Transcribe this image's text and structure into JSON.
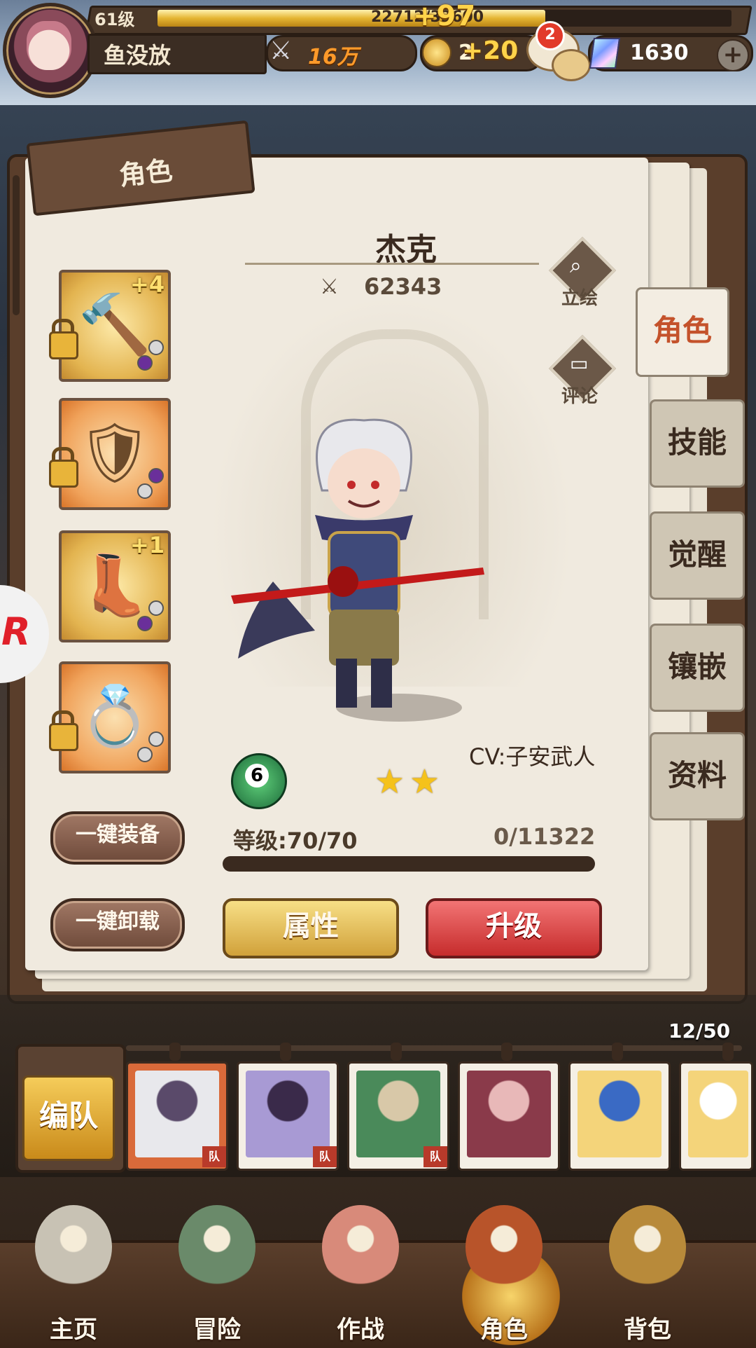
{
  "player": {
    "level": "61级",
    "name": "鱼没放",
    "xp_text": "22712/33600",
    "xp_fraction": 0.676,
    "xp_gain": "+97"
  },
  "resources": {
    "power": "16万",
    "gold": "2",
    "gold_gain": "+20",
    "gems": "1630",
    "chat_badge": "2",
    "plus": "+"
  },
  "panel": {
    "tab_title": "角色",
    "character_name": "杰克",
    "character_power": "62343",
    "portrait_label": "立绘",
    "comment_label": "评论",
    "cv": "CV:子安武人",
    "rank": "6",
    "stars": 2,
    "level_text": "等级:70/70",
    "exp_text": "0/11322",
    "exp_fraction": 0
  },
  "equipment": [
    {
      "name": "hammer",
      "icon": "hammer-icon",
      "glyph": "🔨",
      "plus": "+4",
      "locked": true,
      "frame": "gold",
      "dots": [
        "#d8d8d8",
        "#6a2f9a"
      ]
    },
    {
      "name": "armor",
      "icon": "armor-icon",
      "glyph": "🛡",
      "plus": "",
      "locked": true,
      "frame": "orange",
      "dots": [
        "#6a2f9a",
        "#d8d8d8"
      ]
    },
    {
      "name": "boots",
      "icon": "boots-icon",
      "glyph": "👢",
      "plus": "+1",
      "locked": false,
      "frame": "gold",
      "dots": [
        "#d8d8d8",
        "#6a2f9a"
      ]
    },
    {
      "name": "ring",
      "icon": "ring-icon",
      "glyph": "💍",
      "plus": "",
      "locked": true,
      "frame": "orange",
      "dots": [
        "#d8d8d8",
        "#d8d8d8"
      ]
    }
  ],
  "buttons": {
    "equip_all": "一键装备",
    "unequip_all": "一键卸载",
    "attributes": "属性",
    "upgrade": "升级",
    "team": "编队"
  },
  "side_tabs": [
    {
      "label": "角色",
      "active": true
    },
    {
      "label": "技能",
      "active": false
    },
    {
      "label": "觉醒",
      "active": false
    },
    {
      "label": "镶嵌",
      "active": false
    },
    {
      "label": "资料",
      "active": false
    }
  ],
  "roster": {
    "count": "12/50",
    "team_flag": "队",
    "cards": [
      {
        "hero": "jack",
        "selected": true,
        "in_team": true,
        "colors": [
          "#e8e8ec",
          "#5a4a6a"
        ]
      },
      {
        "hero": "purple-hair-girl",
        "selected": false,
        "in_team": true,
        "colors": [
          "#a89ad4",
          "#3a2a4a"
        ]
      },
      {
        "hero": "green-hair-man",
        "selected": false,
        "in_team": true,
        "colors": [
          "#4a8a5a",
          "#d8c8a8"
        ]
      },
      {
        "hero": "red-hair-girl",
        "selected": false,
        "in_team": false,
        "colors": [
          "#8a3a4a",
          "#e8b8b8"
        ]
      },
      {
        "hero": "blonde-blue-bow-girl",
        "selected": false,
        "in_team": false,
        "colors": [
          "#f4d47a",
          "#3a6ac4"
        ]
      },
      {
        "hero": "blonde-boy",
        "selected": false,
        "in_team": false,
        "colors": [
          "#f4d47a",
          "#ffffff"
        ]
      }
    ]
  },
  "nav": [
    {
      "label": "主页",
      "icon": "castle-icon",
      "active": false
    },
    {
      "label": "冒险",
      "icon": "portal-icon",
      "active": false
    },
    {
      "label": "作战",
      "icon": "battle-icon",
      "active": false
    },
    {
      "label": "角色",
      "icon": "book-icon",
      "active": true
    },
    {
      "label": "背包",
      "icon": "backpack-icon",
      "active": false
    }
  ],
  "overlay": {
    "floating_badge": "R"
  },
  "colors": {
    "accent_red": "#c4522b",
    "gold": "#e5b532",
    "panel": "#f0eadf",
    "frame": "#5a3e2b"
  }
}
